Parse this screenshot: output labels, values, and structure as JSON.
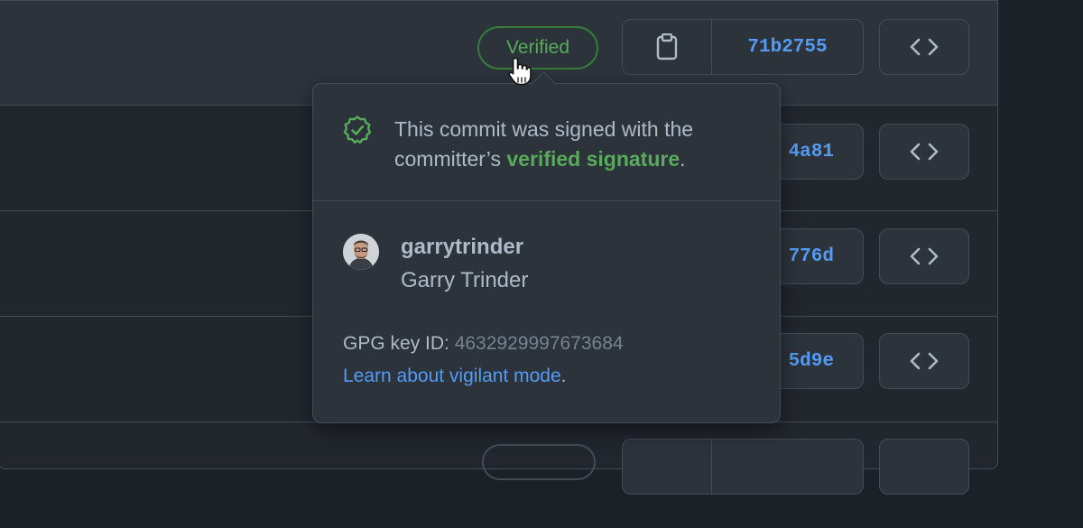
{
  "rows": [
    {
      "sha": "71b2755"
    },
    {
      "sha": "4a81"
    },
    {
      "sha": "776d"
    },
    {
      "sha": "5d9e"
    },
    {
      "sha": ""
    }
  ],
  "badge": {
    "label": "Verified"
  },
  "popover": {
    "message_prefix": "This commit was signed with the committer’s ",
    "message_link": "verified signature",
    "message_suffix": ".",
    "login": "garrytrinder",
    "name": "Garry Trinder",
    "gpg_label": "GPG key ID: ",
    "gpg_key": "4632929997673684",
    "learn_link": "Learn about vigilant mode",
    "learn_suffix": "."
  },
  "icons": {
    "copy": "clipboard-icon",
    "browse": "code-icon",
    "verified": "verified-check-icon",
    "cursor": "hand-pointer-icon"
  },
  "colors": {
    "accent_blue": "#539bf5",
    "success_green": "#57ab5a",
    "border": "#444c56"
  }
}
